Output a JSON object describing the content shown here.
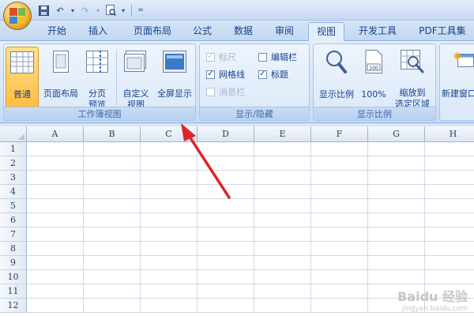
{
  "title_bar": {
    "window_title": "",
    "qat": [
      "save-icon",
      "undo-icon",
      "redo-icon",
      "print-preview-icon",
      "customize-icon"
    ]
  },
  "tabs": [
    {
      "label": "开始",
      "active": false
    },
    {
      "label": "插入",
      "active": false
    },
    {
      "label": "页面布局",
      "active": false
    },
    {
      "label": "公式",
      "active": false
    },
    {
      "label": "数据",
      "active": false
    },
    {
      "label": "审阅",
      "active": false
    },
    {
      "label": "视图",
      "active": true
    },
    {
      "label": "开发工具",
      "active": false
    },
    {
      "label": "PDF工具集",
      "active": false
    }
  ],
  "ribbon": {
    "workbook_views": {
      "label": "工作簿视图",
      "normal": "普通",
      "page_layout": "页面布局",
      "page_break_1": "分页",
      "page_break_2": "预览",
      "custom_1": "自定义",
      "custom_2": "视图",
      "full_screen": "全屏显示"
    },
    "show_hide": {
      "label": "显示/隐藏",
      "ruler": "标尺",
      "formula_bar": "编辑栏",
      "gridlines": "网格线",
      "headings": "标题",
      "message_bar": "消息栏",
      "ruler_checked": true,
      "formula_bar_checked": false,
      "gridlines_checked": true,
      "headings_checked": true,
      "message_bar_checked": false
    },
    "zoom": {
      "label": "显示比例",
      "zoom": "显示比例",
      "hundred": "100%",
      "to_sel_1": "缩放到",
      "to_sel_2": "选定区域"
    },
    "window": {
      "new_window_1": "新建窗口"
    }
  },
  "sheet": {
    "columns": [
      "A",
      "B",
      "C",
      "D",
      "E",
      "F",
      "G",
      "H"
    ],
    "rows": [
      "1",
      "2",
      "3",
      "4",
      "5",
      "6",
      "7",
      "8",
      "9",
      "10",
      "11",
      "12"
    ]
  },
  "colors": {
    "accent": "#15428b",
    "arrow": "#e0242b",
    "selected_button": "#ffc95a"
  },
  "watermark": {
    "text": "Baidu 经验",
    "sub": "jingyan.baidu.com"
  }
}
